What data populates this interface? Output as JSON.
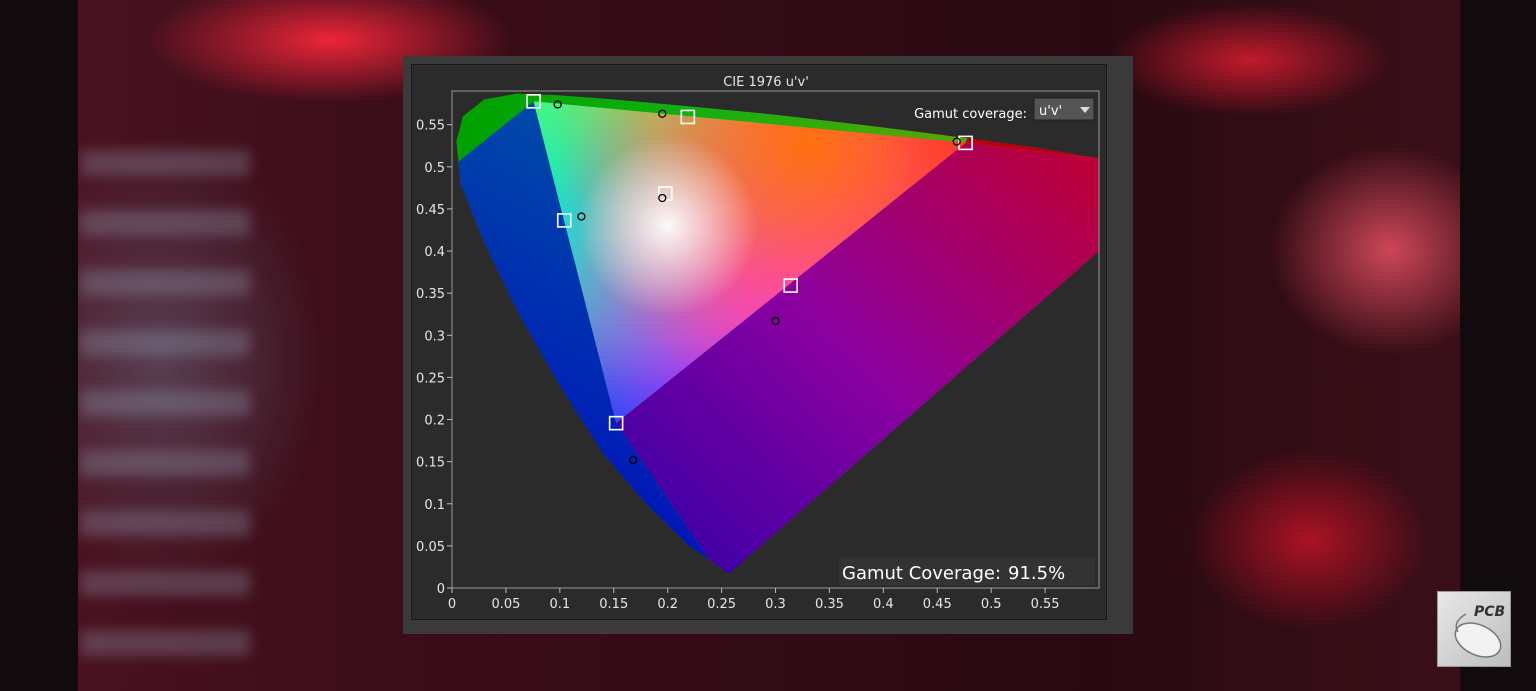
{
  "chart_data": {
    "type": "scatter",
    "title": "CIE 1976 u'v'",
    "xlim": [
      0,
      0.6
    ],
    "ylim": [
      0,
      0.59
    ],
    "x_ticks": [
      "0",
      "0.05",
      "0.1",
      "0.15",
      "0.2",
      "0.25",
      "0.3",
      "0.35",
      "0.4",
      "0.45",
      "0.5",
      "0.55"
    ],
    "y_ticks": [
      "0",
      "0.05",
      "0.1",
      "0.15",
      "0.2",
      "0.25",
      "0.3",
      "0.35",
      "0.4",
      "0.45",
      "0.5",
      "0.55"
    ],
    "grid": false,
    "spectral_locus": [
      [
        0.257,
        0.017
      ],
      [
        0.22,
        0.05
      ],
      [
        0.18,
        0.1
      ],
      [
        0.14,
        0.16
      ],
      [
        0.1,
        0.24
      ],
      [
        0.06,
        0.33
      ],
      [
        0.03,
        0.41
      ],
      [
        0.008,
        0.48
      ],
      [
        0.004,
        0.53
      ],
      [
        0.01,
        0.56
      ],
      [
        0.03,
        0.58
      ],
      [
        0.06,
        0.587
      ],
      [
        0.1,
        0.585
      ],
      [
        0.15,
        0.58
      ],
      [
        0.22,
        0.572
      ],
      [
        0.3,
        0.562
      ],
      [
        0.38,
        0.55
      ],
      [
        0.46,
        0.537
      ],
      [
        0.54,
        0.523
      ],
      [
        0.6,
        0.51
      ]
    ],
    "target_gamut": {
      "red": [
        0.4763,
        0.5284
      ],
      "green": [
        0.0757,
        0.5777
      ],
      "blue": [
        0.1522,
        0.1957
      ]
    },
    "target_points": [
      [
        0.4763,
        0.5284
      ],
      [
        0.0757,
        0.5777
      ],
      [
        0.1522,
        0.1957
      ],
      [
        0.2187,
        0.5592
      ],
      [
        0.1041,
        0.4364
      ],
      [
        0.3141,
        0.359
      ],
      [
        0.1978,
        0.4683
      ]
    ],
    "measured_points": [
      [
        0.468,
        0.53
      ],
      [
        0.098,
        0.574
      ],
      [
        0.168,
        0.152
      ],
      [
        0.195,
        0.563
      ],
      [
        0.12,
        0.441
      ],
      [
        0.3,
        0.317
      ],
      [
        0.195,
        0.463
      ]
    ],
    "dropdown": {
      "label": "Gamut coverage:",
      "value": "u'v'"
    },
    "coverage": {
      "label": "Gamut Coverage:",
      "value": "91.5%"
    },
    "colors": {
      "target_marker": "#ffffff",
      "measured_marker": "#000000",
      "plot_background": "#2b2b2b"
    }
  },
  "logo": {
    "text": "PCB"
  }
}
